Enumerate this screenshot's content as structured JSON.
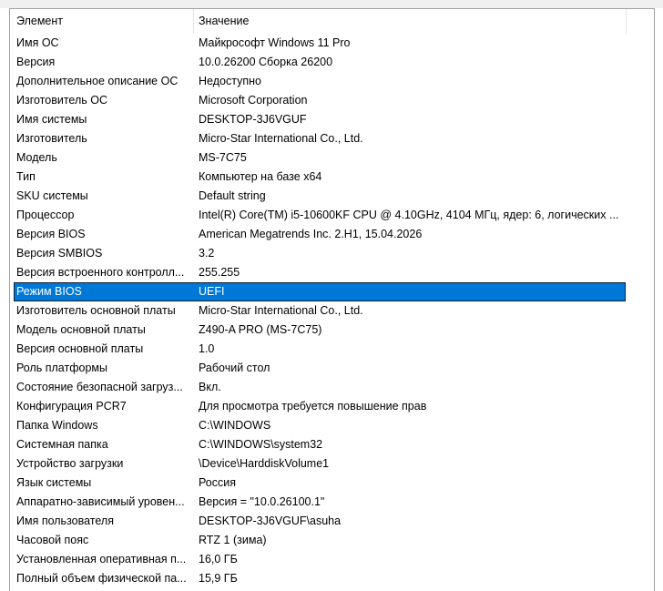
{
  "header": {
    "col_name": "Элемент",
    "col_value": "Значение"
  },
  "colors": {
    "selection": "#0078d7",
    "selection_text": "#ffffff"
  },
  "rows": [
    {
      "name": "Имя ОС",
      "value": "Майкрософт Windows 11 Pro"
    },
    {
      "name": "Версия",
      "value": "10.0.26200 Сборка 26200"
    },
    {
      "name": "Дополнительное описание ОС",
      "value": "Недоступно"
    },
    {
      "name": "Изготовитель ОС",
      "value": "Microsoft Corporation"
    },
    {
      "name": "Имя системы",
      "value": "DESKTOP-3J6VGUF"
    },
    {
      "name": "Изготовитель",
      "value": "Micro-Star International Co., Ltd."
    },
    {
      "name": "Модель",
      "value": "MS-7C75"
    },
    {
      "name": "Тип",
      "value": "Компьютер на базе x64"
    },
    {
      "name": "SKU системы",
      "value": "Default string"
    },
    {
      "name": "Процессор",
      "value": "Intel(R) Core(TM) i5-10600KF CPU @ 4.10GHz, 4104 МГц, ядер: 6, логических ..."
    },
    {
      "name": "Версия BIOS",
      "value": "American Megatrends Inc. 2.H1, 15.04.2026"
    },
    {
      "name": "Версия SMBIOS",
      "value": "3.2"
    },
    {
      "name": "Версия встроенного контролл...",
      "value": "255.255"
    },
    {
      "name": "Режим BIOS",
      "value": "UEFI",
      "selected": true
    },
    {
      "name": "Изготовитель основной платы",
      "value": "Micro-Star International Co., Ltd."
    },
    {
      "name": "Модель основной платы",
      "value": "Z490-A PRO (MS-7C75)"
    },
    {
      "name": "Версия основной платы",
      "value": "1.0"
    },
    {
      "name": "Роль платформы",
      "value": "Рабочий стол"
    },
    {
      "name": "Состояние безопасной загруз...",
      "value": "Вкл."
    },
    {
      "name": "Конфигурация PCR7",
      "value": "Для просмотра требуется повышение прав"
    },
    {
      "name": "Папка Windows",
      "value": "C:\\WINDOWS"
    },
    {
      "name": "Системная папка",
      "value": "C:\\WINDOWS\\system32"
    },
    {
      "name": "Устройство загрузки",
      "value": "\\Device\\HarddiskVolume1"
    },
    {
      "name": "Язык системы",
      "value": "Россия"
    },
    {
      "name": "Аппаратно-зависимый уровен...",
      "value": "Версия = \"10.0.26100.1\""
    },
    {
      "name": "Имя пользователя",
      "value": "DESKTOP-3J6VGUF\\asuha"
    },
    {
      "name": "Часовой пояс",
      "value": "RTZ 1 (зима)"
    },
    {
      "name": "Установленная оперативная п...",
      "value": "16,0 ГБ"
    },
    {
      "name": "Полный объем физической па...",
      "value": "15,9 ГБ"
    }
  ]
}
